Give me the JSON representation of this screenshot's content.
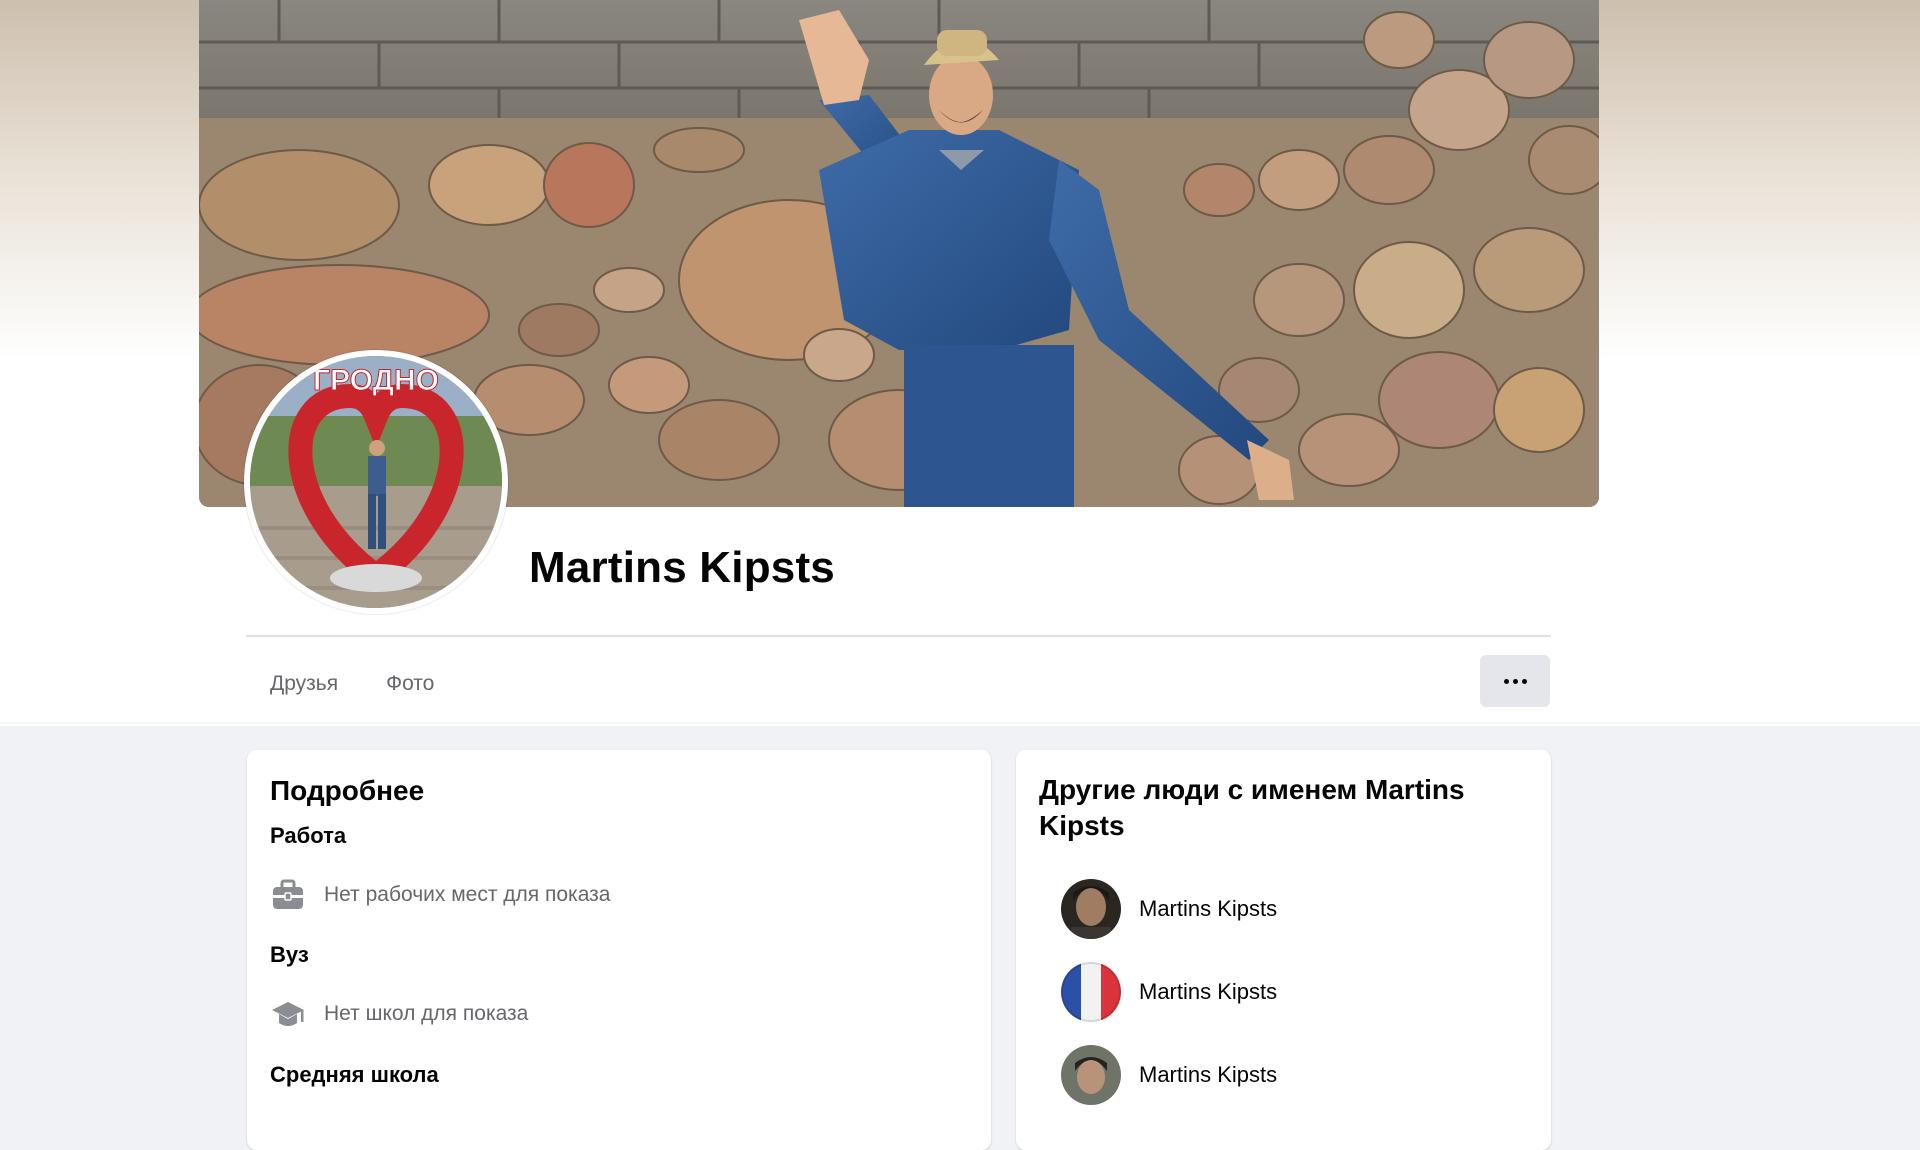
{
  "profile": {
    "name": "Martins Kipsts",
    "avatar_caption": "ГРОДНО"
  },
  "tabs": [
    {
      "label": "Друзья"
    },
    {
      "label": "Фото"
    }
  ],
  "more_icon": "ellipsis-icon",
  "details": {
    "title": "Подробнее",
    "work_label": "Работа",
    "work_empty": "Нет рабочих мест для показа",
    "work_icon": "briefcase-icon",
    "university_label": "Вуз",
    "university_empty": "Нет школ для показа",
    "university_icon": "graduation-cap-icon",
    "high_school_label": "Средняя школа"
  },
  "other_people": {
    "title": "Другие люди с именем Martins Kipsts",
    "people": [
      {
        "name": "Martins Kipsts"
      },
      {
        "name": "Martins Kipsts"
      },
      {
        "name": "Martins Kipsts"
      }
    ]
  },
  "colors": {
    "page_bg": "#f0f2f5",
    "card_bg": "#ffffff",
    "secondary_text": "#65676b",
    "button_bg": "#e4e6eb"
  }
}
